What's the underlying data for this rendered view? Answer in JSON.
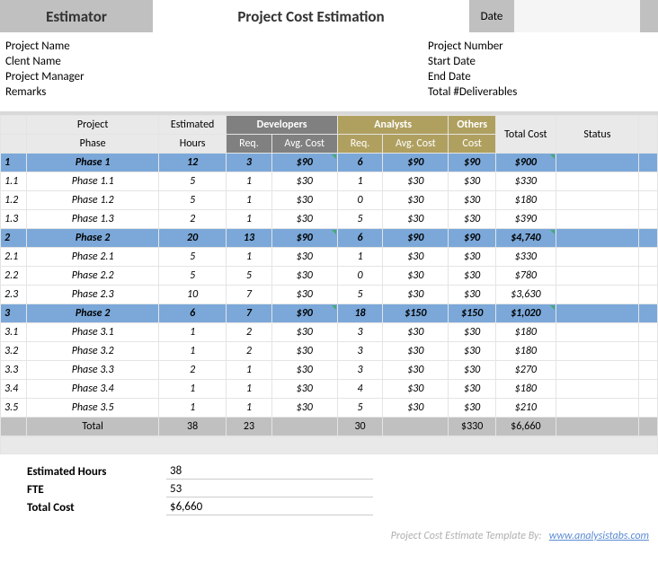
{
  "header": {
    "estimator": "Estimator",
    "title": "Project Cost Estimation",
    "date_label": "Date",
    "date_value": ""
  },
  "meta": {
    "left": [
      {
        "label": "Project Name",
        "value": ""
      },
      {
        "label": "Clent Name",
        "value": ""
      },
      {
        "label": "Project Manager",
        "value": ""
      },
      {
        "label": "Remarks",
        "value": ""
      }
    ],
    "right": [
      {
        "label": "Project Number",
        "value": ""
      },
      {
        "label": "Start Date",
        "value": ""
      },
      {
        "label": "End Date",
        "value": ""
      },
      {
        "label": "Total #Deliverables",
        "value": ""
      }
    ]
  },
  "columns": {
    "project": "Project",
    "phase": "Phase",
    "estimated": "Estimated",
    "hours": "Hours",
    "developers": "Developers",
    "analysts": "Analysts",
    "req": "Req.",
    "avg_cost": "Avg. Cost",
    "others": "Others",
    "cost": "Cost",
    "total_cost": "Total Cost",
    "status": "Status"
  },
  "chart_data": {
    "type": "table",
    "rows": [
      {
        "idx": "1",
        "phase": "Phase 1",
        "hours": "12",
        "dev_req": "3",
        "dev_avg": "$90",
        "ana_req": "6",
        "ana_avg": "$90",
        "others": "$90",
        "total": "$900",
        "status": "",
        "kind": "blue"
      },
      {
        "idx": "1.1",
        "phase": "Phase 1.1",
        "hours": "5",
        "dev_req": "1",
        "dev_avg": "$30",
        "ana_req": "1",
        "ana_avg": "$30",
        "others": "$30",
        "total": "$330",
        "status": "",
        "kind": "norm"
      },
      {
        "idx": "1.2",
        "phase": "Phase 1.2",
        "hours": "5",
        "dev_req": "1",
        "dev_avg": "$30",
        "ana_req": "0",
        "ana_avg": "$30",
        "others": "$30",
        "total": "$180",
        "status": "",
        "kind": "norm"
      },
      {
        "idx": "1.3",
        "phase": "Phase 1.3",
        "hours": "2",
        "dev_req": "1",
        "dev_avg": "$30",
        "ana_req": "5",
        "ana_avg": "$30",
        "others": "$30",
        "total": "$390",
        "status": "",
        "kind": "norm"
      },
      {
        "idx": "2",
        "phase": "Phase 2",
        "hours": "20",
        "dev_req": "13",
        "dev_avg": "$90",
        "ana_req": "6",
        "ana_avg": "$90",
        "others": "$90",
        "total": "$4,740",
        "status": "",
        "kind": "blue"
      },
      {
        "idx": "2.1",
        "phase": "Phase 2.1",
        "hours": "5",
        "dev_req": "1",
        "dev_avg": "$30",
        "ana_req": "1",
        "ana_avg": "$30",
        "others": "$30",
        "total": "$330",
        "status": "",
        "kind": "norm"
      },
      {
        "idx": "2.2",
        "phase": "Phase 2.2",
        "hours": "5",
        "dev_req": "5",
        "dev_avg": "$30",
        "ana_req": "0",
        "ana_avg": "$30",
        "others": "$30",
        "total": "$780",
        "status": "",
        "kind": "norm"
      },
      {
        "idx": "2.3",
        "phase": "Phase 2.3",
        "hours": "10",
        "dev_req": "7",
        "dev_avg": "$30",
        "ana_req": "5",
        "ana_avg": "$30",
        "others": "$30",
        "total": "$3,630",
        "status": "",
        "kind": "norm"
      },
      {
        "idx": "3",
        "phase": "Phase 2",
        "hours": "6",
        "dev_req": "7",
        "dev_avg": "$90",
        "ana_req": "18",
        "ana_avg": "$150",
        "others": "$150",
        "total": "$1,020",
        "status": "",
        "kind": "blue"
      },
      {
        "idx": "3.1",
        "phase": "Phase 3.1",
        "hours": "1",
        "dev_req": "2",
        "dev_avg": "$30",
        "ana_req": "3",
        "ana_avg": "$30",
        "others": "$30",
        "total": "$180",
        "status": "",
        "kind": "norm"
      },
      {
        "idx": "3.2",
        "phase": "Phase 3.2",
        "hours": "1",
        "dev_req": "2",
        "dev_avg": "$30",
        "ana_req": "3",
        "ana_avg": "$30",
        "others": "$30",
        "total": "$180",
        "status": "",
        "kind": "norm"
      },
      {
        "idx": "3.3",
        "phase": "Phase 3.3",
        "hours": "2",
        "dev_req": "1",
        "dev_avg": "$30",
        "ana_req": "3",
        "ana_avg": "$30",
        "others": "$30",
        "total": "$270",
        "status": "",
        "kind": "norm"
      },
      {
        "idx": "3.4",
        "phase": "Phase 3.4",
        "hours": "1",
        "dev_req": "1",
        "dev_avg": "$30",
        "ana_req": "4",
        "ana_avg": "$30",
        "others": "$30",
        "total": "$180",
        "status": "",
        "kind": "norm"
      },
      {
        "idx": "3.5",
        "phase": "Phase 3.5",
        "hours": "1",
        "dev_req": "1",
        "dev_avg": "$30",
        "ana_req": "5",
        "ana_avg": "$30",
        "others": "$30",
        "total": "$210",
        "status": "",
        "kind": "norm"
      }
    ],
    "totals": {
      "label": "Total",
      "hours": "38",
      "dev_req": "23",
      "ana_req": "30",
      "others": "$330",
      "total": "$6,660"
    }
  },
  "summary": {
    "estimated_hours": {
      "label": "Estimated Hours",
      "value": "38"
    },
    "fte": {
      "label": "FTE",
      "value": "53"
    },
    "total_cost": {
      "label": "Total Cost",
      "value": "$6,660"
    }
  },
  "footer": {
    "text": "Project Cost Estimate Template By:",
    "link": "www.analysistabs.com"
  }
}
